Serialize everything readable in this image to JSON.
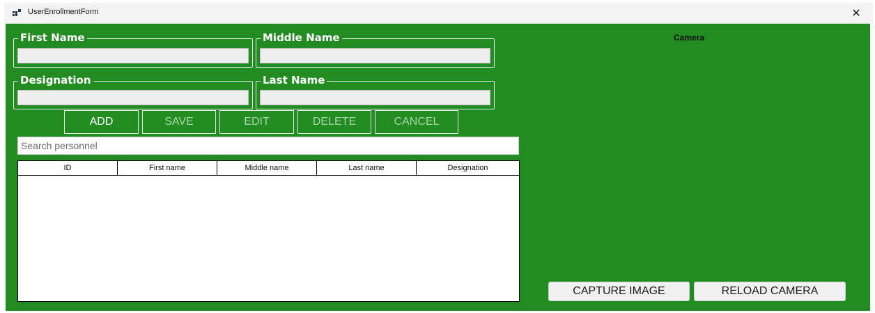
{
  "window": {
    "title": "UserEnrollmentForm",
    "close_glyph": "✕",
    "background_color": "#228b22"
  },
  "form": {
    "first_name_label": "First Name",
    "middle_name_label": "Middle Name",
    "designation_label": "Designation",
    "last_name_label": "Last Name",
    "first_name_value": "",
    "middle_name_value": "",
    "designation_value": "",
    "last_name_value": ""
  },
  "buttons": {
    "add": "ADD",
    "save": "SAVE",
    "edit": "EDIT",
    "delete": "DELETE",
    "cancel": "CANCEL"
  },
  "search": {
    "placeholder": "Search personnel"
  },
  "table": {
    "columns": [
      "ID",
      "First name",
      "Middle name",
      "Last name",
      "Designation"
    ],
    "rows": []
  },
  "camera": {
    "label": "Camera",
    "capture_button": "CAPTURE IMAGE",
    "reload_button": "RELOAD CAMERA"
  }
}
